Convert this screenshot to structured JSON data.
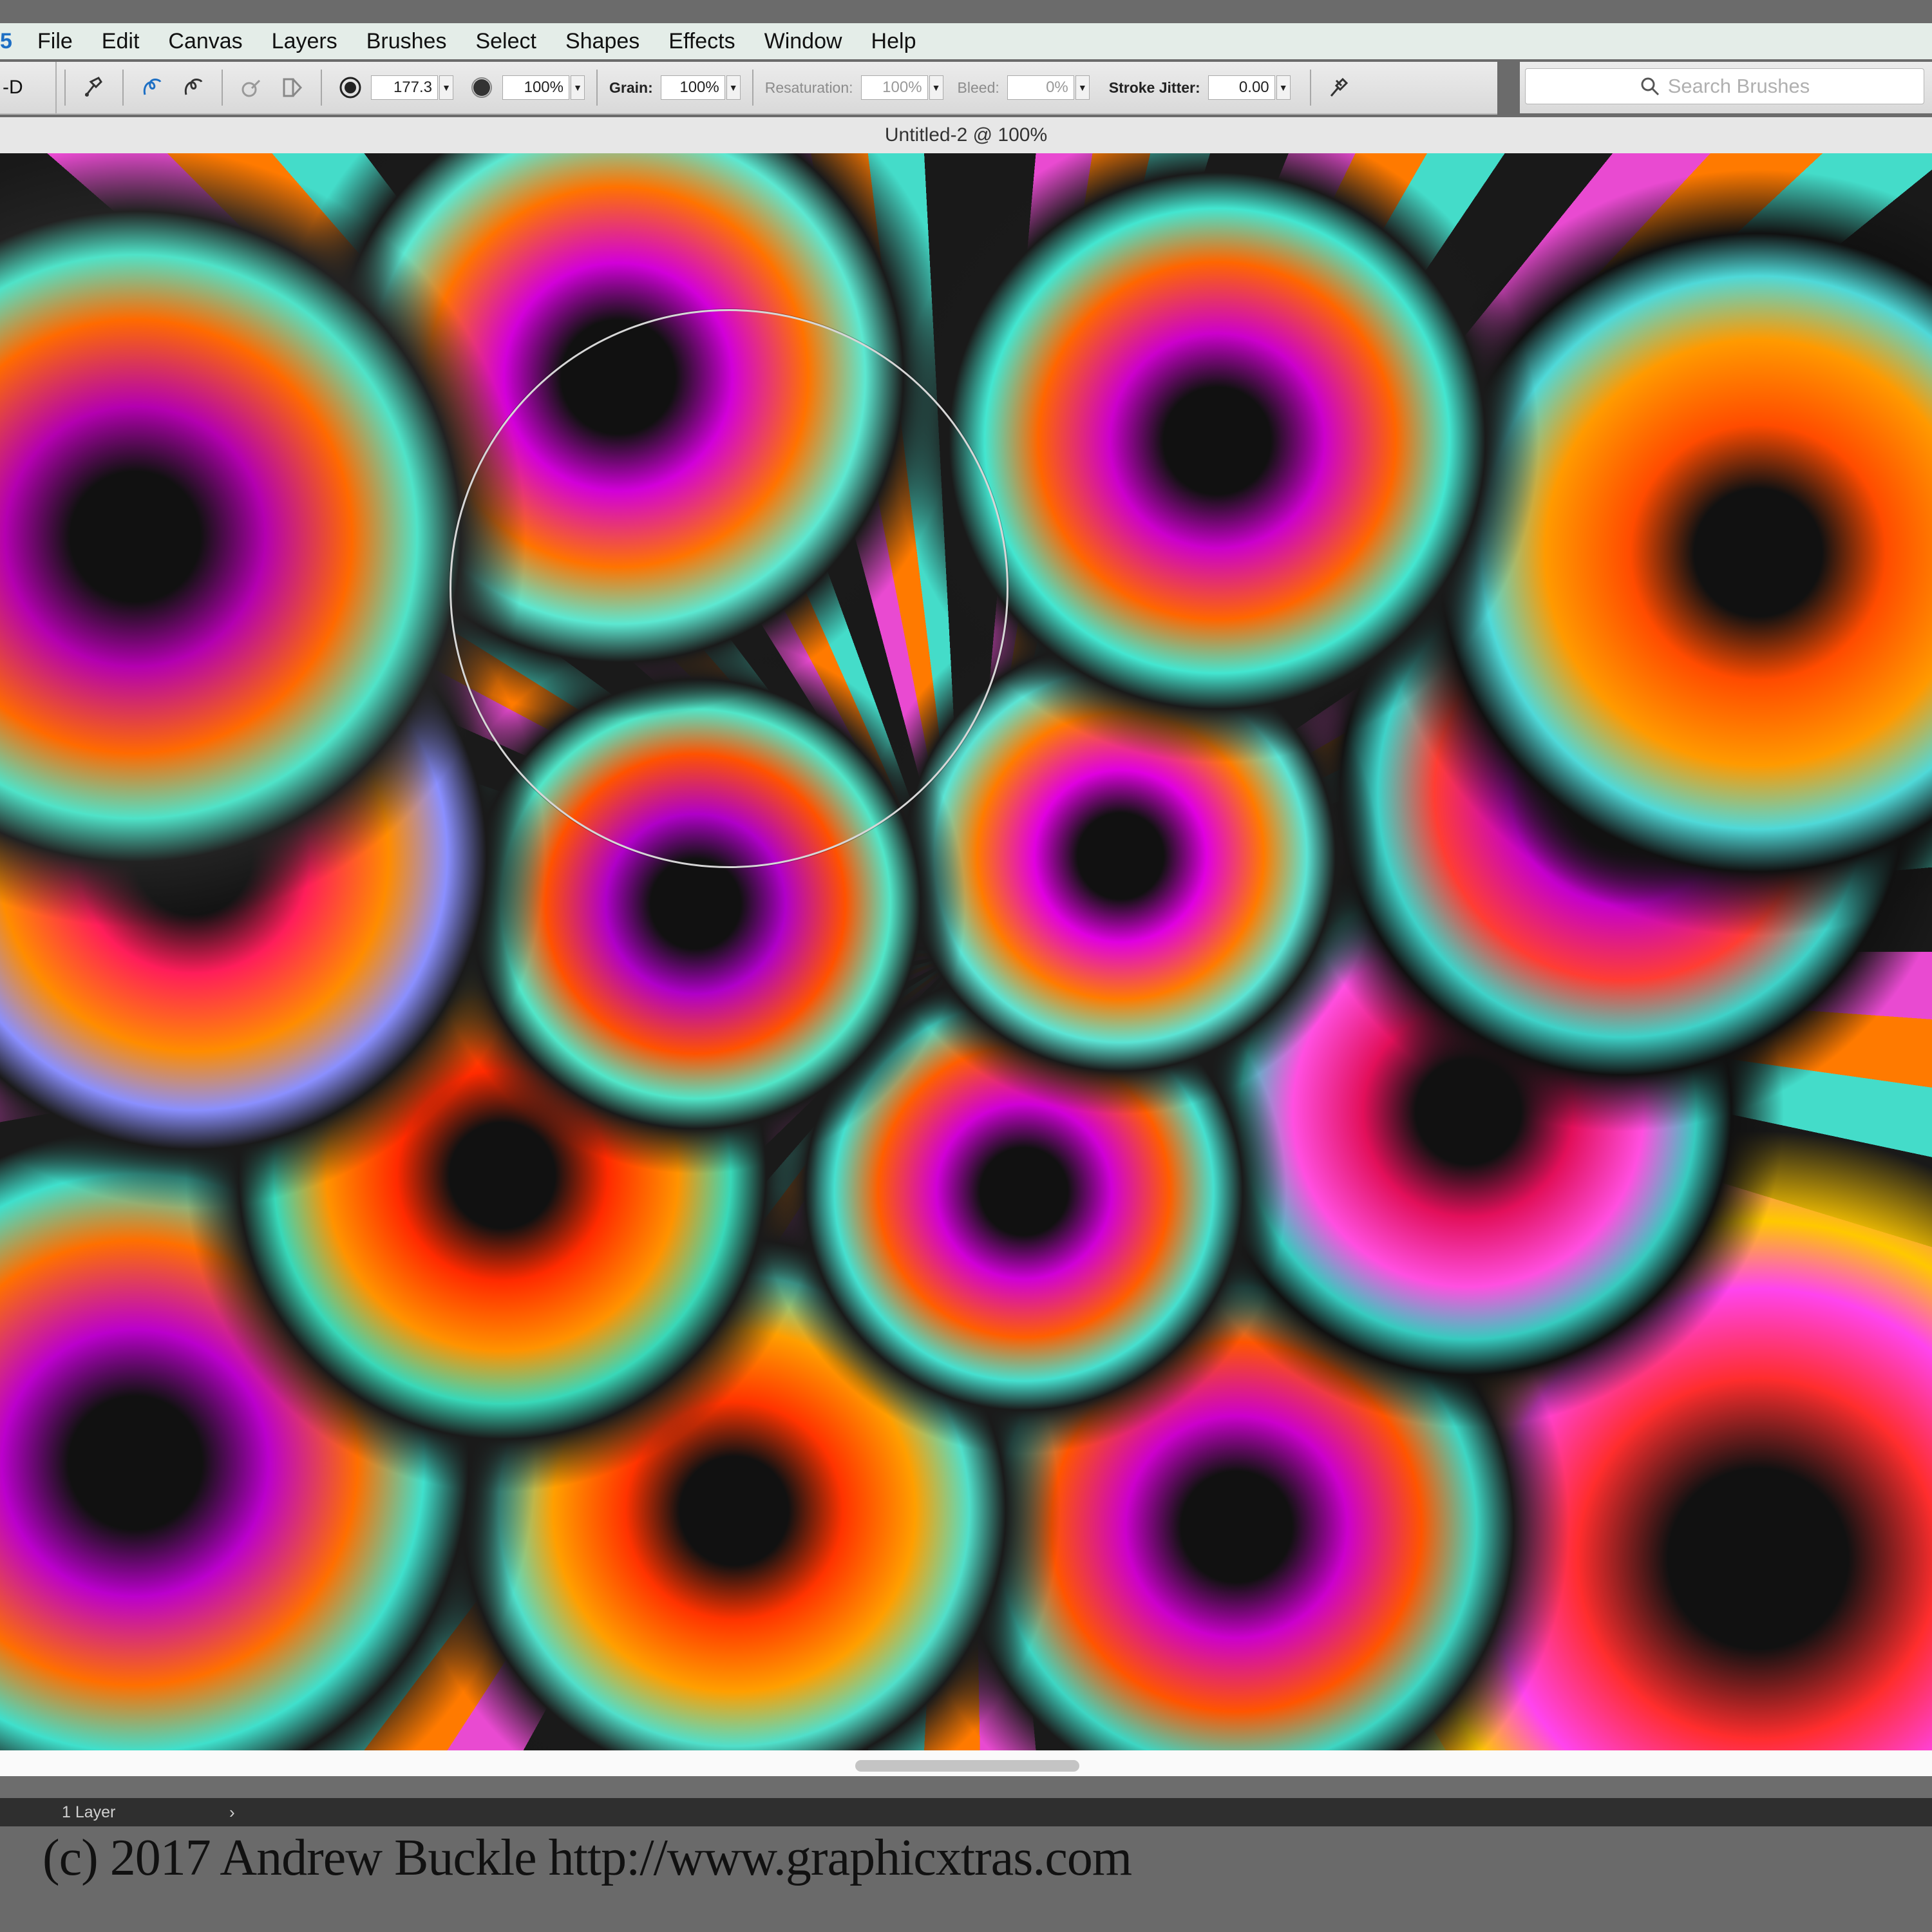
{
  "menubar": {
    "app_number": "5",
    "items": [
      "File",
      "Edit",
      "Canvas",
      "Layers",
      "Brushes",
      "Select",
      "Shapes",
      "Effects",
      "Window",
      "Help"
    ]
  },
  "toolbar": {
    "left_label": "-D",
    "size_value": "177.3",
    "opacity_value": "100%",
    "grain_label": "Grain:",
    "grain_value": "100%",
    "resaturation_label": "Resaturation:",
    "resaturation_value": "100%",
    "bleed_label": "Bleed:",
    "bleed_value": "0%",
    "stroke_jitter_label": "Stroke Jitter:",
    "stroke_jitter_value": "0.00"
  },
  "search": {
    "placeholder": "Search Brushes"
  },
  "document": {
    "title": "Untitled-2 @ 100%"
  },
  "layers": {
    "label": "1 Layer"
  },
  "footer": {
    "copyright": "(c) 2017 Andrew Buckle http://www.graphicxtras.com"
  },
  "colors": {
    "menu_bg": "#e4ede8",
    "accent_blue": "#1d6fc4",
    "toolbar_bg": "#e2e2e2"
  },
  "icons": [
    "brush-tool-icon",
    "cloner-icon",
    "dropper-icon",
    "brush-ghost-icon",
    "symmetry-icon",
    "brush-size-icon",
    "opacity-icon",
    "brush-settings-icon",
    "search-icon",
    "chevron-right-icon"
  ]
}
